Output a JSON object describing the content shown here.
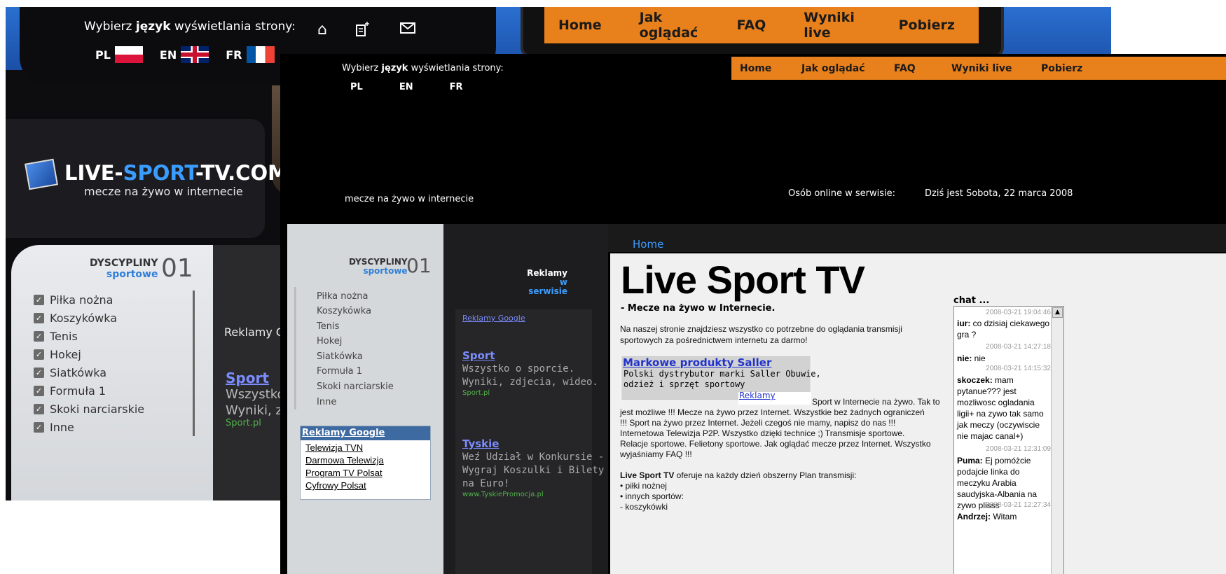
{
  "background": {
    "lang_prompt_pre": "Wybierz ",
    "lang_prompt_bold": "język",
    "lang_prompt_post": " wyświetlania strony:",
    "langs": [
      "PL",
      "EN",
      "FR"
    ],
    "icons": [
      "home-icon",
      "add-page-icon",
      "mail-icon"
    ],
    "nav": [
      "Home",
      "Jak oglądać",
      "FAQ",
      "Wyniki live",
      "Pobierz"
    ],
    "logo_left": "LIVE-",
    "logo_accent": "SPORT",
    "logo_right": "-TV.COM",
    "logo_sub": "mecze na żywo w internecie",
    "disc_title_1": "DYSCYPLINY",
    "disc_title_2": "sportowe",
    "disc_num": "01",
    "categories": [
      "Piłka nożna",
      "Koszykówka",
      "Tenis",
      "Hokej",
      "Siatkówka",
      "Formuła 1",
      "Skoki narciarskie",
      "Inne"
    ],
    "ads_title": "Reklamy Go",
    "ad_sport": "Sport",
    "ad_l1": "Wszystko",
    "ad_l2": "Wyniki, zd",
    "ad_url": "Sport.pl"
  },
  "page": {
    "lang_prompt_pre": "Wybierz ",
    "lang_prompt_bold": "język",
    "lang_prompt_post": " wyświetlania strony:",
    "langs": [
      "PL",
      "EN",
      "FR"
    ],
    "nav": [
      "Home",
      "Jak oglądać",
      "FAQ",
      "Wyniki live",
      "Pobierz"
    ],
    "slogan": "mecze na żywo w internecie",
    "online_label": "Osób online w serwisie:",
    "date": "Dziś jest Sobota, 22 marca 2008",
    "disc_title_1": "DYSCYPLINY",
    "disc_title_2": "sportowe",
    "disc_num": "01",
    "categories": [
      "Piłka nożna",
      "Koszykówka",
      "Tenis",
      "Hokej",
      "Siatkówka",
      "Formuła 1",
      "Skoki narciarskie",
      "Inne"
    ],
    "google_box": {
      "head": "Reklamy Google",
      "links": [
        "Telewizja TVN",
        "Darmowa Telewizja",
        "Program TV Polsat",
        "Cyfrowy Polsat"
      ]
    },
    "ads": {
      "title_1": "Reklamy",
      "title_2": "w serwisie",
      "google_link": "Reklamy Google",
      "ad1_head": "Sport",
      "ad1_l1": "Wszystko o sporcie.",
      "ad1_l2": "Wyniki, zdjecia, wideo.",
      "ad1_url": "Sport.pl",
      "ad2_head": "Tyskie",
      "ad2_l1": "Weź Udział w Konkursie -",
      "ad2_l2": "Wygraj Koszulki i Bilety",
      "ad2_l3": "na Euro!",
      "ad2_url": "www.TyskiePromocja.pl"
    },
    "breadcrumb": "Home",
    "title": "Live Sport TV",
    "subtitle": "- Mecze na żywo w Internecie.",
    "intro_1": "Na naszej stronie znajdziesz wszystko co potrzebne do oglądania transmisji",
    "intro_2": "sportowych za pośrednictwem internetu za darmo!",
    "adbox": {
      "head": "Markowe produkty Saller",
      "l1": "Polski dystrybutor marki Saller Obuwie,",
      "l2": "odzież i sprzęt sportowy",
      "link": "Reklamy"
    },
    "body_1": "Sport w Internecie na żywo. Tak to",
    "body_2": "jest możliwe !!! Mecze na żywo przez Internet. Wszystkie bez żadnych ograniczeń",
    "body_3": "!!! Sport na żywo przez Internet. Jeżeli czegoś nie mamy, napisz do nas !!!",
    "body_4": "Internetowa Telewizja P2P. Wszystko dzięki technice ;) Transmisje sportowe.",
    "body_5": "Relacje sportowe. Felietony sportowe. Jak oglądać mecze przez Internet. Wszystko",
    "body_6": "wyjaśniamy FAQ !!!",
    "plan_bold": "Live Sport TV",
    "plan_text": " oferuje na każdy dzień obszerny Plan transmisji:",
    "plan_items": [
      "• piłki nożnej",
      "• innych sportów:",
      "- koszykówki"
    ],
    "chat": {
      "title": "chat ...",
      "entries": [
        {
          "time": "2008-03-21 19:04:46",
          "user": "iur:",
          "text": " co dzisiaj ciekawego gra ?"
        },
        {
          "time": "2008-03-21 14:27:18",
          "user": "nie:",
          "text": " nie"
        },
        {
          "time": "2008-03-21 14:15:32",
          "user": "skoczek:",
          "text": " mam pytanue??? jest mozliwosc ogladania ligii+ na zywo tak samo jak meczy (oczywiscie nie majac canal+)"
        },
        {
          "time": "2008-03-21 12:31:09",
          "user": "Puma:",
          "text": " Ej pomóżcie podajcie linka do meczyku Arabia saudyjska-Albania na zywo plisss"
        },
        {
          "time": "2008-03-21 12:27:34",
          "user": "Andrzej:",
          "text": " Witam"
        }
      ]
    }
  }
}
